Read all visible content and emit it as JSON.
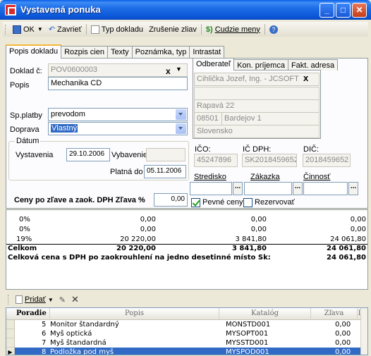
{
  "window": {
    "title": "Vystavená ponuka",
    "colors": {
      "titlebar": "#0B55D6",
      "selection": "#316AC5",
      "active_tab": "#F7B73A"
    }
  },
  "toolbar": {
    "ok_label": "OK",
    "close_label": "Zavrieť",
    "doc_type_label": "Typ dokladu",
    "cancel_discounts_label": "Zrušenie zliav",
    "foreign_currency_label": "Cudzie meny"
  },
  "tabs": [
    "Popis dokladu",
    "Rozpis cien",
    "Texty",
    "Poznámka, typ",
    "Intrastat"
  ],
  "form": {
    "doklad_label": "Doklad č:",
    "doklad_value": "POV0600003",
    "popis_label": "Popis",
    "popis_value": "Mechanika CD",
    "spplatby_label": "Sp.platby",
    "spplatby_value": "prevodom",
    "doprava_label": "Doprava",
    "doprava_value": "Vlastný",
    "datum_group": "Dátum",
    "vystavenia_label": "Vystavenia",
    "vystavenia_value": "29.10.2006",
    "vybavenie_label": "Vybavenie",
    "vybavenie_value": "",
    "platnado_label": "Platná do",
    "platnado_value": "05.11.2006",
    "ceny_label": "Ceny po zľave a zaok. DPH  Zľava %",
    "zlava_value": "0,00"
  },
  "customer": {
    "subtabs": [
      "Odberateľ",
      "Kon. príjemca",
      "Fakt. adresa"
    ],
    "name": "Cihlička Jozef, Ing. - JCSOFT",
    "line2": "",
    "street": "Rapavá 22",
    "zip": "08501",
    "city": "Bardejov 1",
    "country": "Slovensko",
    "ico_label": "IČO:",
    "ico_value": "45247896",
    "icdph_label": "IČ DPH:",
    "icdph_value": "SK2018459652",
    "dic_label": "DIČ:",
    "dic_value": "2018459652",
    "stredisko_label": "Stredisko",
    "zakazka_label": "Zákazka",
    "cinnost_label": "Činnosť",
    "pevne_ceny_label": "Pevné ceny",
    "rezervovat_label": "Rezervovať"
  },
  "summary": {
    "rows": [
      {
        "rate": "0%",
        "base": "0,00",
        "vat": "0,00",
        "total": "0,00"
      },
      {
        "rate": "0%",
        "base": "0,00",
        "vat": "0,00",
        "total": "0,00"
      },
      {
        "rate": "19%",
        "base": "20 220,00",
        "vat": "3 841,80",
        "total": "24 061,80"
      }
    ],
    "celkom_label": "Celkom",
    "celkom_base": "20 220,00",
    "celkom_vat": "3 841,80",
    "celkom_total": "24 061,80",
    "rounded_label": "Celková cena s DPH po zaokrouhlení na jedno desetinné místo Sk:",
    "rounded_value": "24 061,80"
  },
  "items_toolbar": {
    "add_label": "Pridať"
  },
  "grid": {
    "headers": [
      "Poradie",
      "Popis",
      "Katalóg",
      "Zľava",
      "I"
    ],
    "rows": [
      {
        "poradie": "5",
        "popis": "Monitor štandardný",
        "katalog": "MONSTD001",
        "zlava": "0,00"
      },
      {
        "poradie": "6",
        "popis": "Myš optická",
        "katalog": "MYSOPT001",
        "zlava": "0,00"
      },
      {
        "poradie": "7",
        "popis": "Myš štandardná",
        "katalog": "MYSSTD001",
        "zlava": "0,00"
      },
      {
        "poradie": "8",
        "popis": "Podložka pod myš",
        "katalog": "MYSPOD001",
        "zlava": "0,00"
      }
    ]
  }
}
